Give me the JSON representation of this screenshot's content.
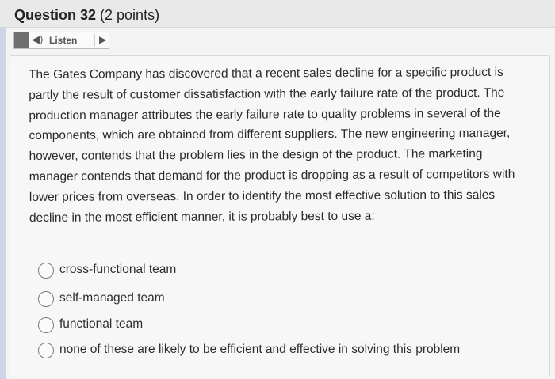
{
  "question": {
    "title_bold": "Question 32",
    "title_rest": " (2 points)",
    "listen_label": "Listen",
    "text": "The Gates Company has discovered that a recent sales decline for a specific product is partly the result of customer dissatisfaction with the early failure rate of the product. The production manager attributes the early failure rate to quality problems in several of the components, which are obtained from different suppliers. The new engineering manager, however, contends that the problem lies in the design of the product. The marketing manager contends that demand for the product is dropping as a result of competitors with lower prices from overseas. In order to identify the most effective solution to this sales decline in the most efficient manner, it is probably best to use a:",
    "options": [
      "cross-functional team",
      "self-managed team",
      "functional team",
      "none of these are likely to be efficient and effective in solving this problem"
    ]
  },
  "icons": {
    "speaker": "speaker-icon",
    "play": "play-icon"
  }
}
